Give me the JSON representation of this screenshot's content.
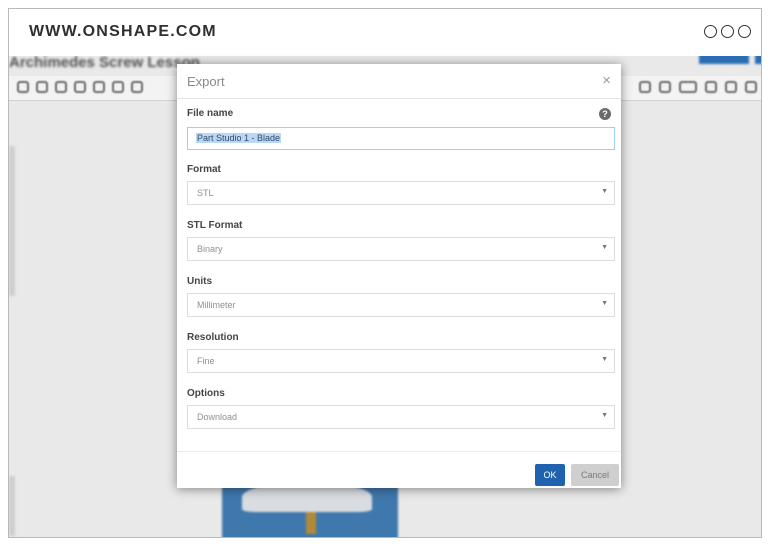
{
  "browser": {
    "url": "WWW.ONSHAPE.COM",
    "menu_icon": "three-dots-icon"
  },
  "app": {
    "doc_title": "Archimedes Screw Lesson"
  },
  "dialog": {
    "title": "Export",
    "close_label": "×",
    "help_label": "?",
    "file_name": {
      "label": "File name",
      "value": "Part Studio 1 - Blade"
    },
    "format": {
      "label": "Format",
      "value": "STL"
    },
    "stl_format": {
      "label": "STL Format",
      "value": "Binary"
    },
    "units": {
      "label": "Units",
      "value": "Millimeter"
    },
    "resolution": {
      "label": "Resolution",
      "value": "Fine"
    },
    "options": {
      "label": "Options",
      "value": "Download"
    },
    "ok_label": "OK",
    "cancel_label": "Cancel"
  },
  "colors": {
    "accent": "#1f63b0",
    "selection": "#bcd7f4",
    "focus_border": "#9fd1ef"
  }
}
